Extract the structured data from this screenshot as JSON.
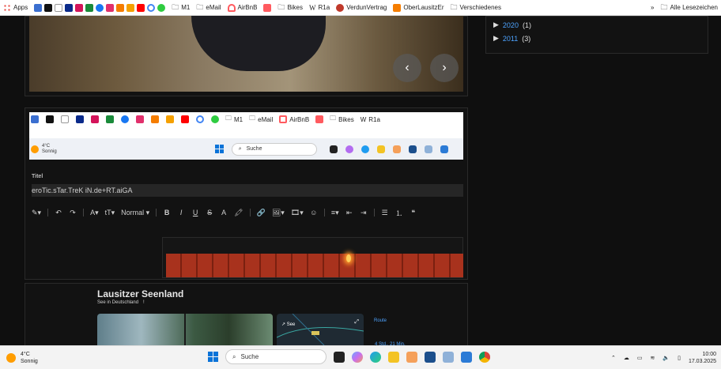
{
  "bookmarks": {
    "items": [
      "Apps",
      "M1",
      "eMail",
      "AirBnB",
      "Bikes",
      "R1a",
      "VerdunVertrag",
      "OberLausitzEr",
      "Verschiedenes"
    ],
    "more": "»",
    "all": "Alle Lesezeichen"
  },
  "archive": [
    {
      "year": "2020",
      "count": "(1)"
    },
    {
      "year": "2011",
      "count": "(3)"
    }
  ],
  "gallery": {
    "prev": "‹",
    "next": "›"
  },
  "screenshot": {
    "bookmarks": [
      "M1",
      "eMail",
      "AirBnB",
      "Bikes",
      "R1a"
    ],
    "weather": {
      "temp": "4°C",
      "cond": "Sonnig"
    },
    "search": "Suche"
  },
  "editor": {
    "title_label": "Titel",
    "title_value": "eroTic.sTar.TreK iN.de+RT.aiGA",
    "format": "Normal"
  },
  "maps": {
    "title": "Lausitzer Seenland",
    "subtitle": "See in Deutschland",
    "subtitle_icon": "!",
    "see_label": "See",
    "route": "Route",
    "time": "4 Std., 21 Min."
  },
  "taskbar": {
    "weather": {
      "temp": "4°C",
      "cond": "Sonnig"
    },
    "search": "Suche",
    "time": "10:00",
    "date": "17.03.2025"
  },
  "colors": {
    "accent": "#4da3ff",
    "windows_blue": "#0a73d8"
  }
}
